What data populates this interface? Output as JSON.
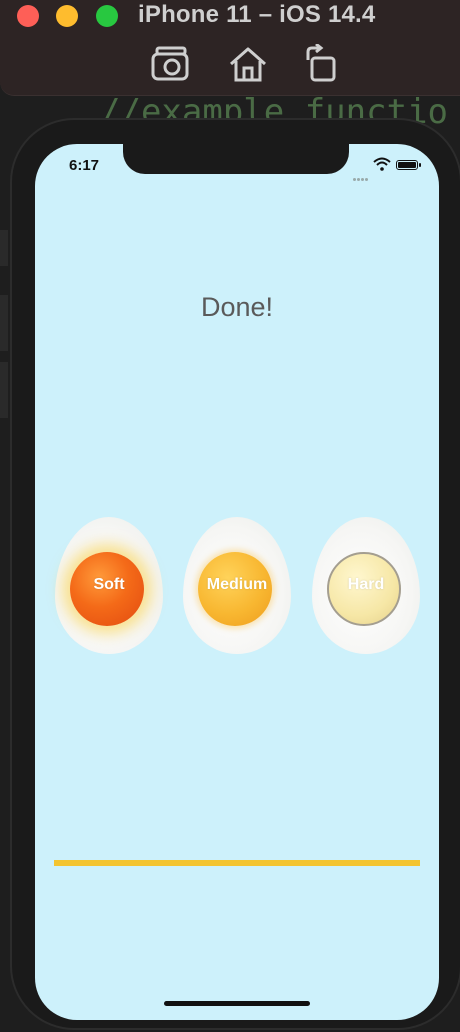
{
  "window": {
    "title": "iPhone 11 – iOS 14.4",
    "toolbar": [
      {
        "name": "screenshot",
        "icon": "camera-icon"
      },
      {
        "name": "home",
        "icon": "home-icon"
      },
      {
        "name": "rotate",
        "icon": "rotate-icon"
      }
    ],
    "background_code": "//example functio"
  },
  "status_bar": {
    "time": "6:17"
  },
  "app": {
    "title_label": "Done!",
    "eggs": [
      {
        "label": "Soft",
        "color": "#f46a18"
      },
      {
        "label": "Medium",
        "color": "#f8b731"
      },
      {
        "label": "Hard",
        "color": "#f6e7a6"
      }
    ],
    "progress": 1.0,
    "progress_color": "#f3c430",
    "background_color": "#cdf1fb"
  }
}
